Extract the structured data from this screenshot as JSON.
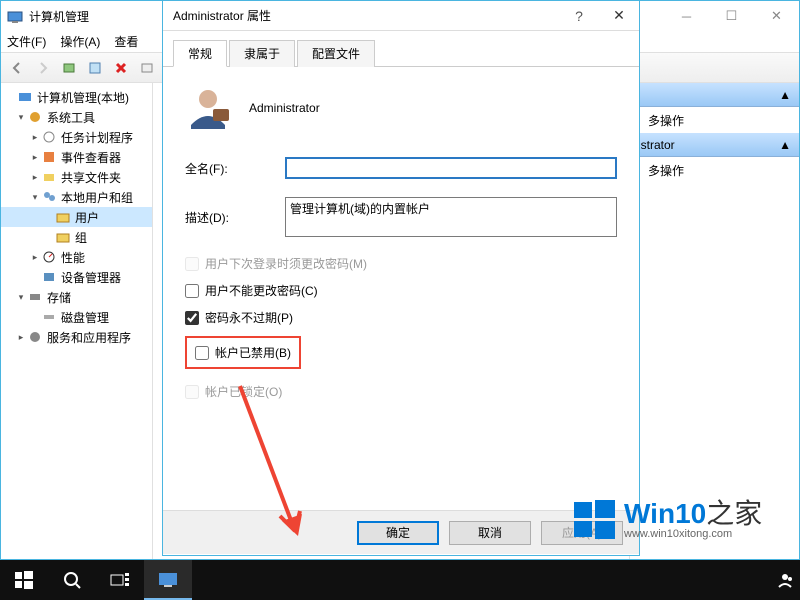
{
  "parent": {
    "title": "计算机管理",
    "menu": [
      "文件(F)",
      "操作(A)",
      "查看"
    ]
  },
  "tree": [
    {
      "label": "计算机管理(本地)",
      "indent": 0,
      "icon": "computer",
      "arrow": ""
    },
    {
      "label": "系统工具",
      "indent": 1,
      "icon": "tools",
      "arrow": "▾"
    },
    {
      "label": "任务计划程序",
      "indent": 2,
      "icon": "sched",
      "arrow": "▸"
    },
    {
      "label": "事件查看器",
      "indent": 2,
      "icon": "event",
      "arrow": "▸"
    },
    {
      "label": "共享文件夹",
      "indent": 2,
      "icon": "share",
      "arrow": "▸"
    },
    {
      "label": "本地用户和组",
      "indent": 2,
      "icon": "users",
      "arrow": "▾"
    },
    {
      "label": "用户",
      "indent": 3,
      "icon": "folder",
      "arrow": "",
      "selected": true
    },
    {
      "label": "组",
      "indent": 3,
      "icon": "folder",
      "arrow": ""
    },
    {
      "label": "性能",
      "indent": 2,
      "icon": "perf",
      "arrow": "▸"
    },
    {
      "label": "设备管理器",
      "indent": 2,
      "icon": "device",
      "arrow": ""
    },
    {
      "label": "存储",
      "indent": 1,
      "icon": "storage",
      "arrow": "▾"
    },
    {
      "label": "磁盘管理",
      "indent": 2,
      "icon": "disk",
      "arrow": ""
    },
    {
      "label": "服务和应用程序",
      "indent": 1,
      "icon": "services",
      "arrow": "▸"
    }
  ],
  "actions": {
    "header1": "多操作",
    "header2": "istrator",
    "header3": "多操作"
  },
  "dialog": {
    "title": "Administrator 属性",
    "tabs": [
      "常规",
      "隶属于",
      "配置文件"
    ],
    "username": "Administrator",
    "fullname_label": "全名(F):",
    "fullname_value": "",
    "desc_label": "描述(D):",
    "desc_value": "管理计算机(域)的内置帐户",
    "check1": "用户下次登录时须更改密码(M)",
    "check2": "用户不能更改密码(C)",
    "check3": "密码永不过期(P)",
    "check4": "帐户已禁用(B)",
    "check5": "帐户已锁定(O)",
    "btn_ok": "确定",
    "btn_cancel": "取消",
    "btn_apply": "应用(A)"
  },
  "watermark": {
    "brand1": "Win10",
    "brand2": "之家",
    "url": "www.win10xitong.com"
  }
}
